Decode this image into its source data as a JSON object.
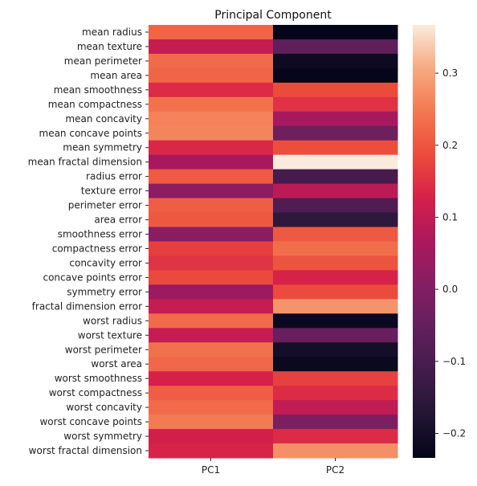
{
  "chart_data": {
    "type": "heatmap",
    "title": "Principal Component",
    "xlabel": "",
    "ylabel": "",
    "columns": [
      "PC1",
      "PC2"
    ],
    "rows": [
      "mean radius",
      "mean texture",
      "mean perimeter",
      "mean area",
      "mean smoothness",
      "mean compactness",
      "mean concavity",
      "mean concave points",
      "mean symmetry",
      "mean fractal dimension",
      "radius error",
      "texture error",
      "perimeter error",
      "area error",
      "smoothness error",
      "compactness error",
      "concavity error",
      "concave points error",
      "symmetry error",
      "fractal dimension error",
      "worst radius",
      "worst texture",
      "worst perimeter",
      "worst area",
      "worst smoothness",
      "worst compactness",
      "worst concavity",
      "worst concave points",
      "worst symmetry",
      "worst fractal dimension"
    ],
    "values": [
      [
        0.219,
        -0.234
      ],
      [
        0.104,
        -0.06
      ],
      [
        0.228,
        -0.215
      ],
      [
        0.221,
        -0.231
      ],
      [
        0.143,
        0.186
      ],
      [
        0.239,
        0.152
      ],
      [
        0.258,
        0.06
      ],
      [
        0.261,
        -0.035
      ],
      [
        0.138,
        0.19
      ],
      [
        0.064,
        0.367
      ],
      [
        0.206,
        -0.106
      ],
      [
        0.017,
        0.09
      ],
      [
        0.211,
        -0.089
      ],
      [
        0.203,
        -0.152
      ],
      [
        0.015,
        0.204
      ],
      [
        0.17,
        0.233
      ],
      [
        0.154,
        0.197
      ],
      [
        0.183,
        0.13
      ],
      [
        0.042,
        0.184
      ],
      [
        0.103,
        0.28
      ],
      [
        0.228,
        -0.22
      ],
      [
        0.104,
        -0.045
      ],
      [
        0.237,
        -0.2
      ],
      [
        0.225,
        -0.219
      ],
      [
        0.128,
        0.172
      ],
      [
        0.21,
        0.144
      ],
      [
        0.229,
        0.098
      ],
      [
        0.251,
        -0.008
      ],
      [
        0.123,
        0.142
      ],
      [
        0.132,
        0.275
      ]
    ],
    "colormap": "rocket",
    "vmin": -0.234,
    "vmax": 0.367,
    "colorbar_ticks": [
      0.3,
      0.2,
      0.1,
      0.0,
      -0.1,
      -0.2
    ],
    "colorbar_tick_labels": [
      "0.3",
      "0.2",
      "0.1",
      "0.0",
      "−0.1",
      "−0.2"
    ],
    "colorbar_placement": "right",
    "grid": false
  }
}
